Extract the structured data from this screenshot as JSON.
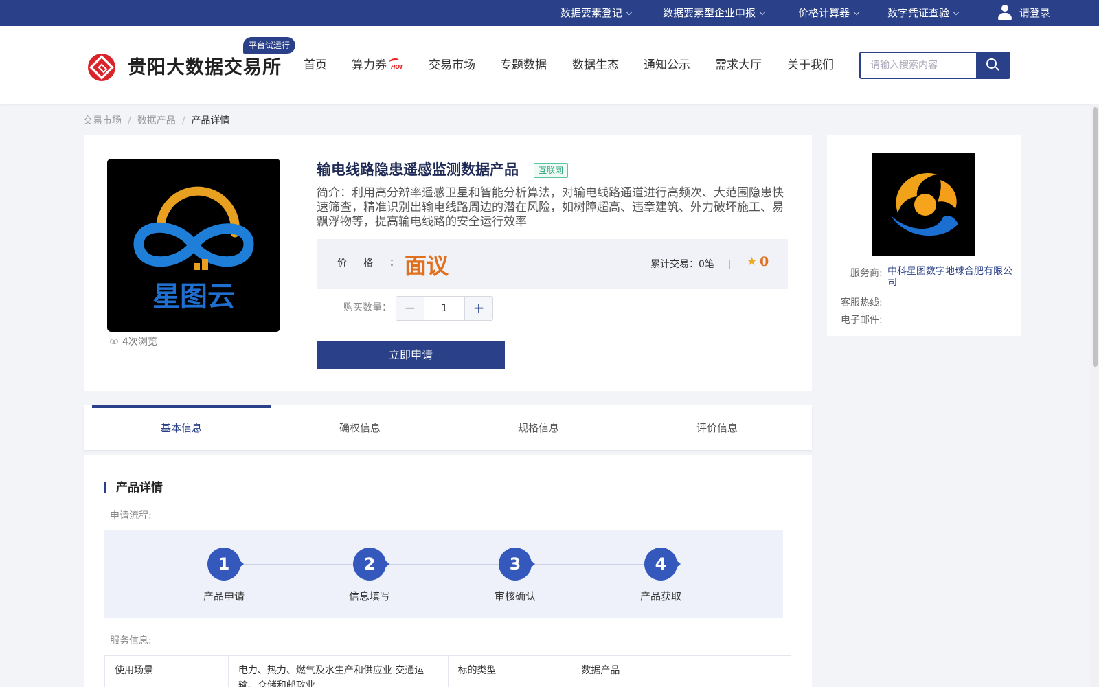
{
  "topbar": {
    "items": [
      {
        "label": "数据要素登记"
      },
      {
        "label": "数据要素型企业申报"
      },
      {
        "label": "价格计算器"
      },
      {
        "label": "数字凭证查验"
      }
    ],
    "login_label": "请登录"
  },
  "header": {
    "site_title": "贵阳大数据交易所",
    "trial_badge": "平台试运行",
    "nav": [
      {
        "label": "首页"
      },
      {
        "label": "算力券"
      },
      {
        "label": "交易市场"
      },
      {
        "label": "专题数据"
      },
      {
        "label": "数据生态"
      },
      {
        "label": "通知公示"
      },
      {
        "label": "需求大厅"
      },
      {
        "label": "关于我们"
      }
    ],
    "hot_label": "HOT",
    "search_placeholder": "请输入搜索内容"
  },
  "breadcrumb": [
    "交易市场",
    "数据产品",
    "产品详情"
  ],
  "product": {
    "title": "输电线路隐患遥感监测数据产品",
    "tag": "互联网",
    "description": "简介：利用高分辨率遥感卫星和智能分析算法，对输电线路通道进行高频次、大范围隐患快速筛查，精准识别出输电线路周边的潜在风险，如树障超高、违章建筑、外力破坏施工、易飘浮物等，提高输电线路的安全运行效率",
    "image_text": "星图云",
    "views": "4次浏览",
    "price_label": "价格",
    "price_value": "面议",
    "trade_label": "累计交易：",
    "trade_count": "0笔",
    "rating": "0",
    "qty_label": "购买数量：",
    "qty_value": "1",
    "apply_label": "立即申请"
  },
  "provider": {
    "service_label": "服务商:",
    "service_name": "中科星图数字地球合肥有限公司",
    "hotline_label": "客服热线:",
    "email_label": "电子邮件:"
  },
  "tabs": [
    {
      "label": "基本信息",
      "active": true
    },
    {
      "label": "确权信息"
    },
    {
      "label": "规格信息"
    },
    {
      "label": "评价信息"
    }
  ],
  "detail": {
    "section_title": "产品详情",
    "process_label": "申请流程:",
    "steps": [
      {
        "num": "1",
        "label": "产品申请"
      },
      {
        "num": "2",
        "label": "信息填写"
      },
      {
        "num": "3",
        "label": "审核确认"
      },
      {
        "num": "4",
        "label": "产品获取"
      }
    ],
    "service_label": "服务信息:",
    "table": [
      {
        "k1": "使用场景",
        "v1": "电力、热力、燃气及水生产和供应业 交通运输、仓储和邮政业",
        "k2": "标的类型",
        "v2": "数据产品"
      }
    ]
  },
  "colors": {
    "brand": "#2a4189",
    "accent": "#e0701e",
    "tag_green": "#2aa57c"
  }
}
